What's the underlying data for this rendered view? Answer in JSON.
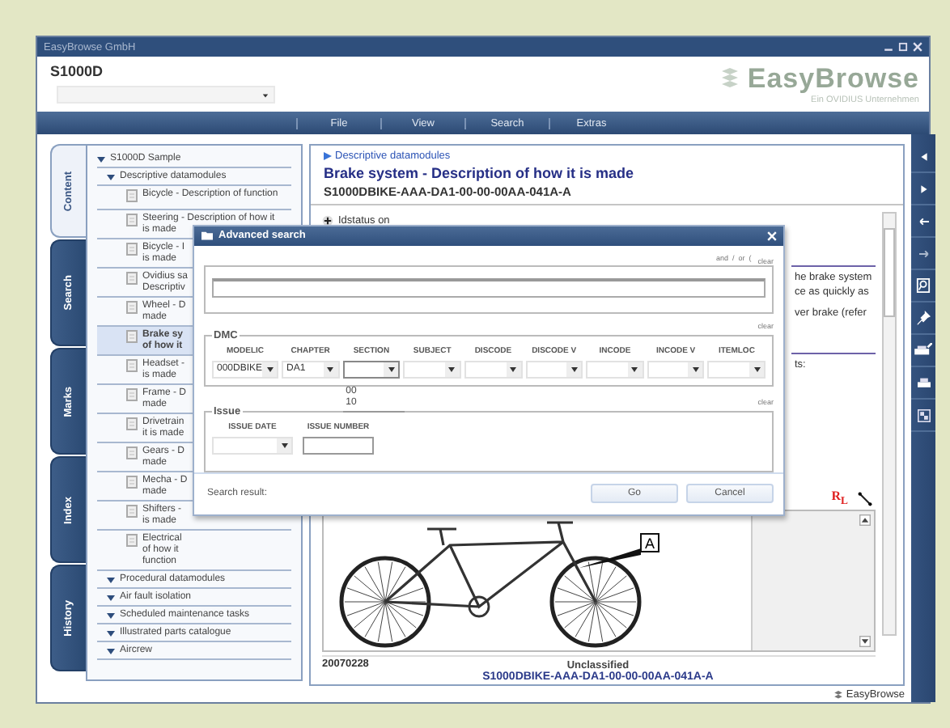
{
  "window": {
    "title": "EasyBrowse GmbH"
  },
  "header": {
    "product": "S1000D",
    "logo": "EasyBrowse",
    "logo_sub": "Ein OVIDIUS Unternehmen"
  },
  "menu": [
    "File",
    "View",
    "Search",
    "Extras"
  ],
  "side_tabs": [
    {
      "label": "Content",
      "selected": true
    },
    {
      "label": "Search",
      "selected": false
    },
    {
      "label": "Marks",
      "selected": false
    },
    {
      "label": "Index",
      "selected": false
    },
    {
      "label": "History",
      "selected": false
    }
  ],
  "tree": [
    {
      "kind": "folder",
      "label": "S1000D Sample",
      "expanded": true,
      "children": [
        {
          "kind": "folder",
          "label": "Descriptive datamodules",
          "expanded": true,
          "children": [
            {
              "kind": "doc",
              "lines": [
                "Bicycle - Description of function"
              ],
              "selected": false
            },
            {
              "kind": "doc",
              "lines": [
                "Steering - Description of how it",
                "is made"
              ],
              "selected": false
            },
            {
              "kind": "doc",
              "lines": [
                "Bicycle - I",
                "is made"
              ],
              "selected": false
            },
            {
              "kind": "doc",
              "lines": [
                "Ovidius sa",
                "Descriptiv"
              ],
              "selected": false
            },
            {
              "kind": "doc",
              "lines": [
                "Wheel - D",
                "made"
              ],
              "selected": false
            },
            {
              "kind": "doc",
              "lines": [
                "Brake sy",
                "of how it"
              ],
              "selected": true
            },
            {
              "kind": "doc",
              "lines": [
                "Headset -",
                "is made"
              ],
              "selected": false
            },
            {
              "kind": "doc",
              "lines": [
                "Frame - D",
                "made"
              ],
              "selected": false
            },
            {
              "kind": "doc",
              "lines": [
                "Drivetrain",
                "it is made"
              ],
              "selected": false
            },
            {
              "kind": "doc",
              "lines": [
                "Gears - D",
                "made"
              ],
              "selected": false
            },
            {
              "kind": "doc",
              "lines": [
                "Mecha - D",
                "made"
              ],
              "selected": false
            },
            {
              "kind": "doc",
              "lines": [
                "Shifters -",
                "is made"
              ],
              "selected": false
            },
            {
              "kind": "doc",
              "lines": [
                "Electrical",
                "of how it",
                "function"
              ],
              "selected": false
            }
          ]
        },
        {
          "kind": "folder",
          "label": "Procedural datamodules",
          "expanded": true
        },
        {
          "kind": "folder",
          "label": "Air fault isolation",
          "expanded": true
        },
        {
          "kind": "folder",
          "label": "Scheduled maintenance tasks",
          "expanded": true
        },
        {
          "kind": "folder",
          "label": "Illustrated parts catalogue",
          "expanded": true
        },
        {
          "kind": "folder",
          "label": "Aircrew",
          "expanded": true
        }
      ]
    }
  ],
  "document": {
    "breadcrumb": "Descriptive datamodules",
    "title": "Brake system - Description of how it is made",
    "code": "S1000DBIKE-AAA-DA1-00-00-00AA-041A-A",
    "idstatus": "Idstatus on",
    "fragments": [
      {
        "lines": [
          "he brake system",
          "ce as quickly as"
        ]
      },
      {
        "lines": [
          "ver brake (refer"
        ]
      },
      {
        "lines": [
          "ts:"
        ]
      }
    ],
    "figure": {
      "tool_label": "R$_{L}$",
      "callout": "A",
      "date": "20070228",
      "classification": "Unclassified",
      "code": "S1000DBIKE-AAA-DA1-00-00-00AA-041A-A"
    }
  },
  "dialog": {
    "title": "Advanced search",
    "query_ops": "and  /  or  (",
    "query_clear": "clear",
    "dmc": {
      "legend": "DMC",
      "clear": "clear",
      "fields": [
        {
          "label": "MODELIC",
          "value": "000DBIKE",
          "open": false
        },
        {
          "label": "CHAPTER",
          "value": "DA1",
          "open": false
        },
        {
          "label": "SECTION",
          "open": true,
          "options": [
            "00",
            "10"
          ]
        },
        {
          "label": "SUBJECT",
          "open": false
        },
        {
          "label": "DISCODE",
          "open": false
        },
        {
          "label": "DISCODE V",
          "open": false
        },
        {
          "label": "INCODE",
          "open": false
        },
        {
          "label": "INCODE V",
          "open": false
        },
        {
          "label": "ITEMLOC",
          "open": false
        }
      ]
    },
    "issue": {
      "legend": "Issue",
      "clear": "clear",
      "date_label": "ISSUE DATE",
      "number_label": "ISSUE NUMBER"
    },
    "result_label": "Search result:",
    "buttons": [
      "Go",
      "Cancel"
    ]
  },
  "status_bar": {
    "brand": "EasyBrowse"
  }
}
